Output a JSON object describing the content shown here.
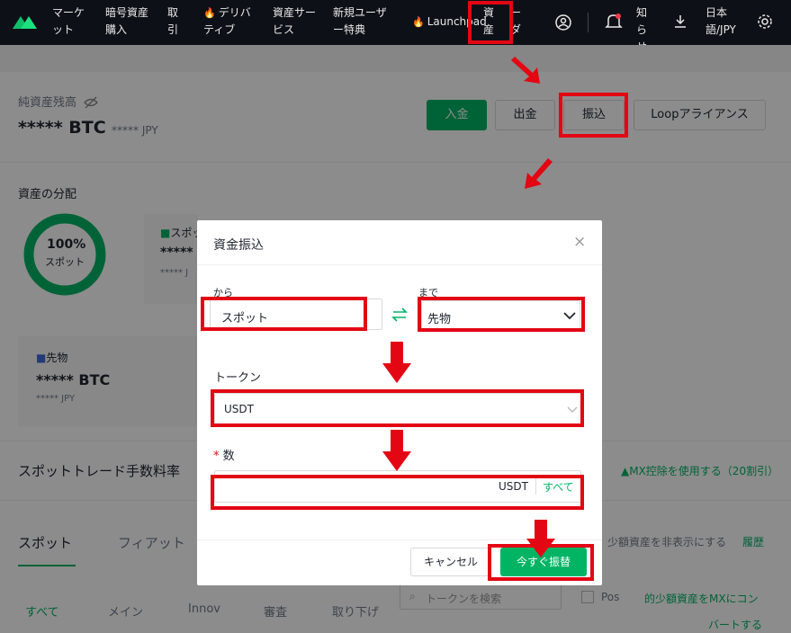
{
  "nav": {
    "markets": "マーケット",
    "buy_crypto": "暗号資産購入",
    "trade": "取引",
    "derivatives": "デリバティブ",
    "asset_services": "資産サービス",
    "new_user": "新規ユーザー特典",
    "launchpad": "Launchpad",
    "assets": "資産",
    "orders_partial": "ーダ",
    "notice": "知らせ",
    "lang": "日本語/JPY"
  },
  "account": {
    "balance_label": "純資産残高",
    "balance_value": "***** BTC",
    "balance_jpy": "***** JPY",
    "deposit": "入金",
    "withdraw": "出金",
    "transfer": "振込",
    "loop": "Loopアライアンス"
  },
  "distribution": {
    "title": "資産の分配",
    "percent": "100%",
    "percent_label": "スポット",
    "spot_label": "スポッ",
    "spot_value": "*****",
    "spot_jpy": "***** J",
    "futures_label": "先物",
    "futures_value": "***** BTC",
    "futures_jpy": "***** JPY"
  },
  "fees": {
    "title": "スポットトレード手数料率",
    "mx_link": "MX控除を使用する（20割引）"
  },
  "tabs": {
    "spot": "スポット",
    "fiat": "フィアット",
    "hide_small": "少額資産を非表示にする",
    "history": "履歴",
    "all": "すべて",
    "main": "メイン",
    "innov": "Innov",
    "review": "審査",
    "delisted": "取り下げ",
    "search_placeholder": "トークンを検索",
    "pos": "Pos",
    "convert_small": "的少額資産をMXにコン",
    "convert_small2": "バートする"
  },
  "modal": {
    "title": "資金振込",
    "from_label": "から",
    "from_value": "スポット",
    "to_label": "まで",
    "to_value": "先物",
    "token_label": "トークン",
    "token_value": "USDT",
    "amount_required": "*",
    "amount_label": "数",
    "amount_unit": "USDT",
    "all_button": "すべて",
    "cancel": "キャンセル",
    "confirm": "今すぐ振替"
  },
  "colors": {
    "accent": "#00b464",
    "highlight": "#e30613",
    "nav_bg": "#0d1117"
  }
}
